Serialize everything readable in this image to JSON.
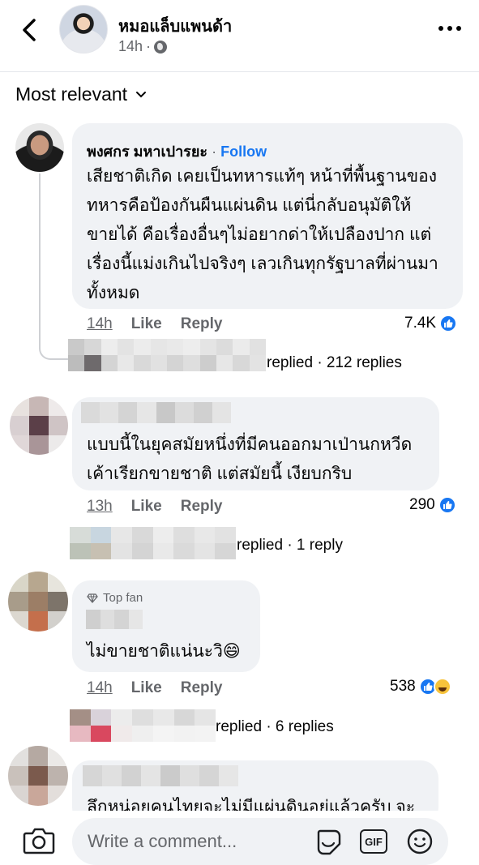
{
  "header": {
    "page_name": "หมอแล็บแพนด้า",
    "time": "14h",
    "dot": "·"
  },
  "sort_label": "Most relevant",
  "comments": [
    {
      "author": "พงศกร มหาเปารยะ",
      "follow": "Follow",
      "text_lines": [
        "เสียชาติเกิด เคยเป็นทหารแท้ๆ หน้าที่พื้นฐานของ",
        "ทหารคือป้องกันผืนแผ่นดิน แต่นี่กลับอนุมัติให้",
        "ขายได้ คือเรื่องอื่นๆไม่อยากด่าให้เปลืองปาก แต่",
        "เรื่องนี้แม่งเกินไปจริงๆ เลวเกินทุกรัฐบาลที่ผ่านมา",
        "ทั้งหมด"
      ],
      "time": "14h",
      "like": "Like",
      "reply": "Reply",
      "reactions": "7.4K",
      "replies_text": "replied · 212 replies"
    },
    {
      "author": "",
      "text_lines": [
        "แบบนี้ในยุคสมัยหนึ่งที่มีคนออกมาเป่านกหวีด",
        "เค้าเรียกขายชาติ แต่สมัยนี้ เงียบกริบ"
      ],
      "time": "13h",
      "like": "Like",
      "reply": "Reply",
      "reactions": "290",
      "replies_text": "replied · 1 reply"
    },
    {
      "badge": "Top fan",
      "author": "",
      "text_lines": [
        "ไม่ขายชาติแน่นะวิ😄"
      ],
      "time": "14h",
      "like": "Like",
      "reply": "Reply",
      "reactions": "538",
      "replies_text": "replied · 6 replies"
    },
    {
      "author": "",
      "text_lines": [
        "ลึกหน่อยคนไทยจะไม่มีแผ่นดินอยู่แล้วครับ จะ"
      ]
    }
  ],
  "composer": {
    "placeholder": "Write a comment...",
    "gif": "GIF"
  },
  "icons": [
    "back-arrow-icon",
    "more-icon",
    "globe-icon",
    "chevron-down-icon",
    "like-reaction-icon",
    "haha-reaction-icon",
    "diamond-icon",
    "camera-icon",
    "sticker-icon",
    "gif-icon",
    "emoji-icon"
  ],
  "colors": {
    "link_blue": "#1877f2",
    "bubble": "#f0f2f5",
    "secondary_text": "#65676b"
  }
}
